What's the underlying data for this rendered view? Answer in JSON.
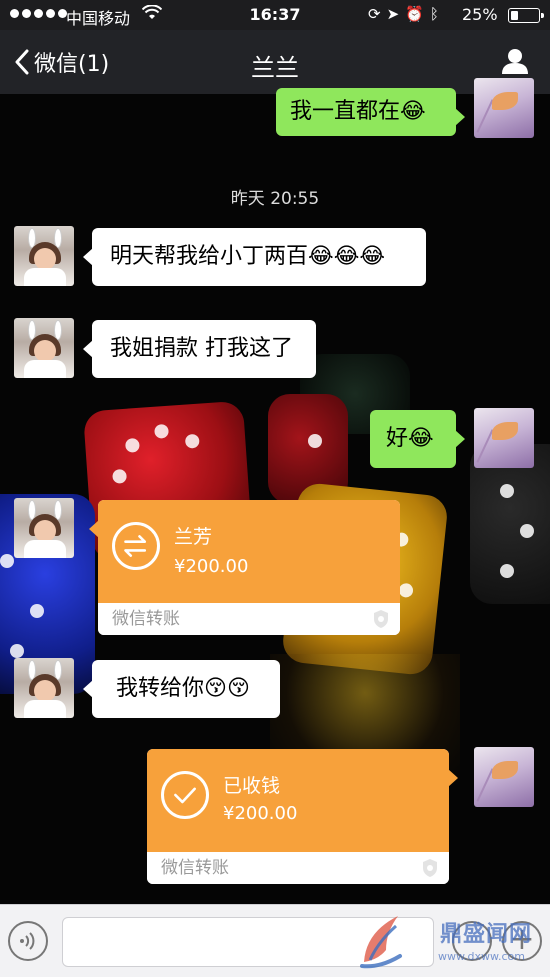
{
  "status_bar": {
    "carrier": "中国移动",
    "time": "16:37",
    "battery": "25%",
    "battery_level": 0.25
  },
  "nav": {
    "back_label": "微信(1)",
    "title": "兰兰"
  },
  "chat": {
    "msg_top_out": {
      "text": "我一直都在",
      "emoji": "😂"
    },
    "timestamp": "昨天 20:55",
    "msg1_in": {
      "text": "明天帮我给小丁两百",
      "emoji": "😂😂😂"
    },
    "msg2_in": {
      "text": "我姐捐款 打我这了"
    },
    "msg3_out": {
      "text": "好",
      "emoji": "😂"
    },
    "transfer_in": {
      "name": "兰芳",
      "amount": "¥200.00",
      "footer": "微信转账"
    },
    "msg4_in": {
      "text": "我转给你",
      "emoji": "😚😚"
    },
    "transfer_out": {
      "name": "已收钱",
      "amount": "¥200.00",
      "footer": "微信转账"
    }
  },
  "watermark": {
    "name": "鼎盛闻网",
    "url": "www.dxww.com"
  },
  "colors": {
    "transfer_orange": "#f7a13b",
    "bubble_green": "#8fe75c",
    "nav_bg": "#222327"
  }
}
